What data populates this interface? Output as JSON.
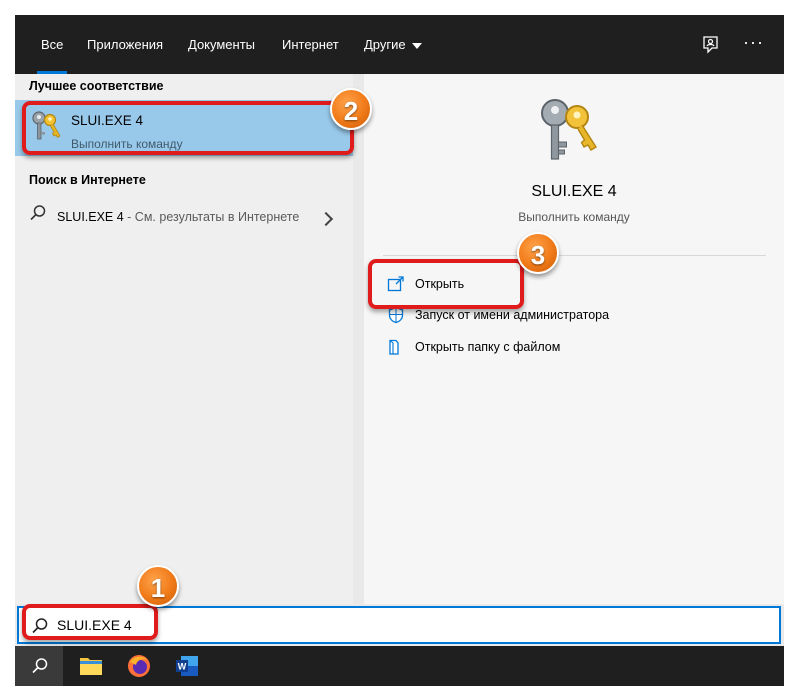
{
  "tabs": [
    {
      "label": "Все",
      "active": true
    },
    {
      "label": "Приложения"
    },
    {
      "label": "Документы"
    },
    {
      "label": "Интернет"
    },
    {
      "label": "Другие"
    }
  ],
  "top_icons": [
    "feedback-icon",
    "more-options-icon"
  ],
  "left": {
    "best_match_title": "Лучшее соответствие",
    "best_match": {
      "title": "SLUI.EXE 4",
      "subtitle": "Выполнить команду",
      "icon": "keys-icon"
    },
    "web_search_title": "Поиск в Интернете",
    "web_result": {
      "query": "SLUI.EXE 4",
      "suffix": " - См. результаты в Интернете"
    }
  },
  "right": {
    "app_name": "SLUI.EXE 4",
    "app_subtitle": "Выполнить команду",
    "actions": [
      {
        "label": "Открыть",
        "icon": "open-icon"
      },
      {
        "label": "Запуск от имени администратора",
        "icon": "shield-icon"
      },
      {
        "label": "Открыть папку с файлом",
        "icon": "folder-icon"
      }
    ]
  },
  "search": {
    "value": "SLUI.EXE 4"
  },
  "taskbar": [
    "search-icon",
    "file-explorer-icon",
    "firefox-icon",
    "word-icon"
  ],
  "annotations": {
    "badge1": "1",
    "badge2": "2",
    "badge3": "3"
  },
  "colors": {
    "accent": "#0078d7",
    "selection": "#99c9ea",
    "highlight": "#e01b1b",
    "badge": "#f07a18"
  }
}
